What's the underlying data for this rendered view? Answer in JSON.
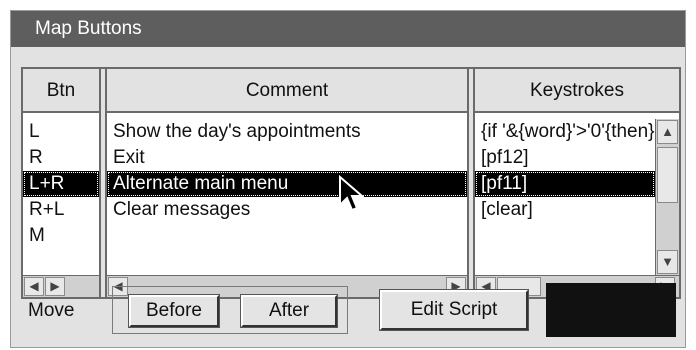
{
  "window": {
    "title": "Map Buttons"
  },
  "columns": {
    "btn": "Btn",
    "comment": "Comment",
    "keystrokes": "Keystrokes"
  },
  "rows": [
    {
      "btn": "L",
      "comment": "Show the day's appointments",
      "keystrokes": "{if '&{word}'>'0'{then}",
      "selected": false
    },
    {
      "btn": "R",
      "comment": "Exit",
      "keystrokes": "[pf12]",
      "selected": false
    },
    {
      "btn": "L+R",
      "comment": "Alternate main menu",
      "keystrokes": "[pf11]",
      "selected": true
    },
    {
      "btn": "R+L",
      "comment": "Clear messages",
      "keystrokes": "[clear]",
      "selected": false
    },
    {
      "btn": "M",
      "comment": "",
      "keystrokes": "",
      "selected": false
    }
  ],
  "footer": {
    "move_label": "Move",
    "before_label": "Before",
    "after_label": "After",
    "edit_script_label": "Edit Script"
  },
  "colors": {
    "title_bg": "#5e5e5e",
    "selection_bg": "#000000",
    "window_bg": "#e2e2e2"
  }
}
